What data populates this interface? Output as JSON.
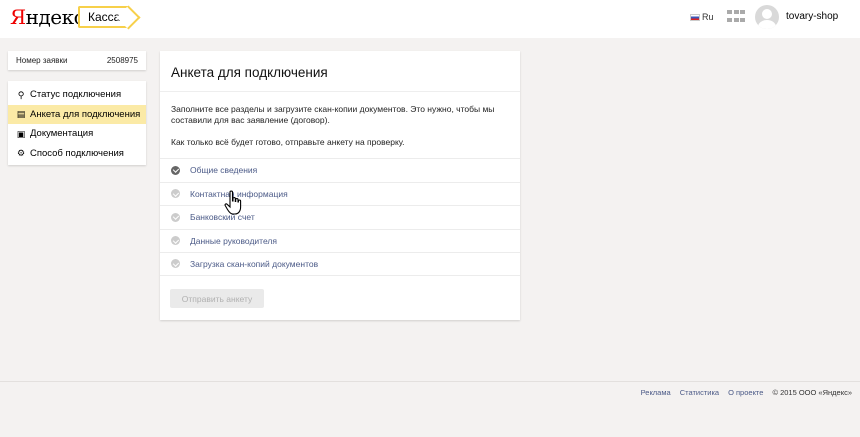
{
  "header": {
    "logo_first_letter": "Я",
    "logo_rest": "ндекс",
    "service": "Касса",
    "lang": "Ru",
    "apps_icon": "apps-grid-icon",
    "avatar_icon": "user-avatar-icon",
    "username": "tovary-shop"
  },
  "sidebar": {
    "order_label": "Номер заявки",
    "order_number": "2508975",
    "items": [
      {
        "label": "Статус подключения",
        "icon": "status-icon",
        "glyph": "⚲"
      },
      {
        "label": "Анкета для подключения",
        "icon": "form-icon",
        "glyph": "▤"
      },
      {
        "label": "Документация",
        "icon": "docs-icon",
        "glyph": "▣"
      },
      {
        "label": "Способ подключения",
        "icon": "plug-icon",
        "glyph": "⚙"
      }
    ],
    "active_index": 1
  },
  "card": {
    "title": "Анкета для подключения",
    "intro": "Заполните все разделы и загрузите скан-копии документов. Это нужно, чтобы мы составили для вас заявление (договор).",
    "intro2": "Как только всё будет готово, отправьте анкету на проверку.",
    "steps": [
      {
        "label": "Общие сведения",
        "done": true
      },
      {
        "label": "Контактная информация",
        "done": false
      },
      {
        "label": "Банковский счет",
        "done": false
      },
      {
        "label": "Данные руководителя",
        "done": false
      },
      {
        "label": "Загрузка скан-копий документов",
        "done": false
      }
    ],
    "submit_label": "Отправить анкету"
  },
  "footer": {
    "links": [
      "Реклама",
      "Статистика",
      "О проекте"
    ],
    "copyright": "© 2015  ООО «Яндекс»"
  },
  "colors": {
    "accent_yellow": "#f7d04a",
    "active_item_bg": "#fbeaa6",
    "link_blue": "#4b5a87",
    "logo_red": "#e00000"
  }
}
